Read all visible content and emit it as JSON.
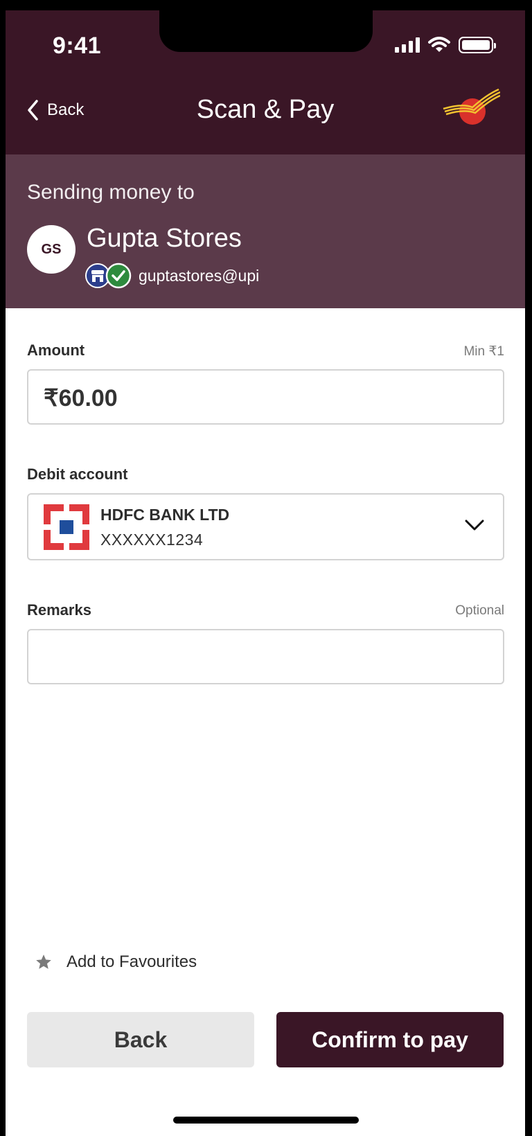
{
  "status_bar": {
    "time": "9:41"
  },
  "header": {
    "back_label": "Back",
    "title": "Scan & Pay"
  },
  "payee": {
    "section_label": "Sending money to",
    "initials": "GS",
    "name": "Gupta Stores",
    "vpa": "guptastores@upi"
  },
  "form": {
    "amount": {
      "label": "Amount",
      "hint": "Min ₹1",
      "value": "₹60.00"
    },
    "debit_account": {
      "label": "Debit account",
      "bank_name": "HDFC BANK LTD",
      "account_number": "XXXXXX1234"
    },
    "remarks": {
      "label": "Remarks",
      "hint": "Optional",
      "value": ""
    }
  },
  "favourites": {
    "label": "Add to Favourites"
  },
  "actions": {
    "back_label": "Back",
    "confirm_label": "Confirm to pay"
  },
  "colors": {
    "primary": "#3a1626",
    "payee_band": "#5b3a4a",
    "verified_green": "#2e8b3e",
    "merchant_blue": "#2c3e8c",
    "hdfc_red": "#e03a3e",
    "hdfc_blue": "#1f4e9c"
  },
  "icons": {
    "back": "chevron-left-icon",
    "brand": "india-post-logo",
    "merchant": "merchant-store-icon",
    "verified": "verified-check-icon",
    "dropdown": "chevron-down-icon",
    "favourite": "star-icon"
  }
}
